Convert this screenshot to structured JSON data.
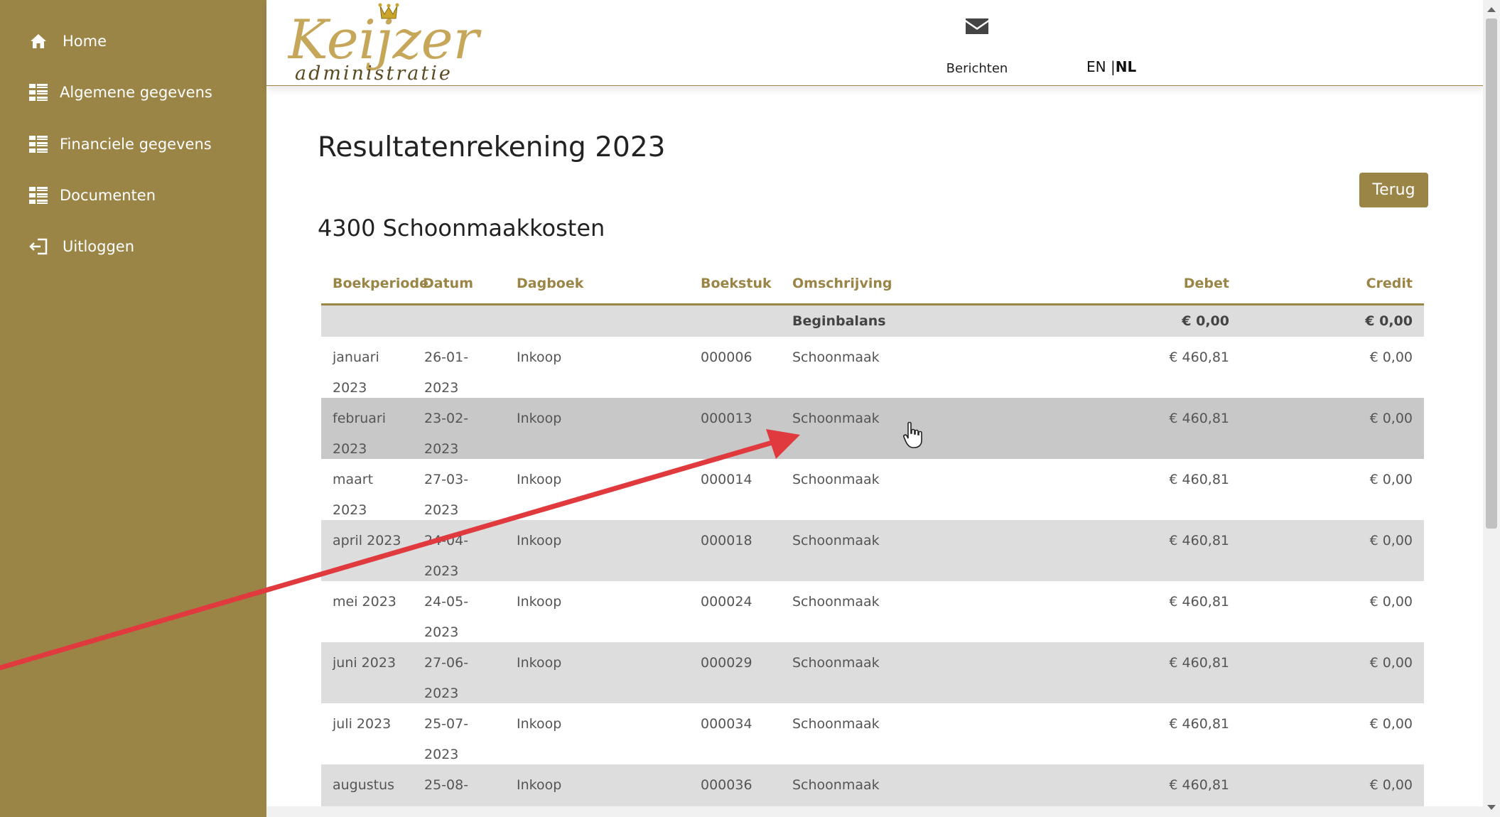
{
  "sidebar": {
    "items": [
      {
        "label": "Home",
        "icon": "home-icon"
      },
      {
        "label": "Algemene gegevens",
        "icon": "list-icon"
      },
      {
        "label": "Financiele gegevens",
        "icon": "list-icon"
      },
      {
        "label": "Documenten",
        "icon": "list-icon"
      },
      {
        "label": "Uitloggen",
        "icon": "logout-icon"
      }
    ]
  },
  "header": {
    "logo_text": "Keijzer",
    "logo_subtext": "administratie",
    "messages_label": "Berichten",
    "lang_en": "EN",
    "lang_sep": "|",
    "lang_nl": "NL"
  },
  "main": {
    "title": "Resultatenrekening 2023",
    "back_label": "Terug",
    "subtitle": "4300 Schoonmaakkosten"
  },
  "table": {
    "headers": {
      "boekperiode": "Boekperiode",
      "datum": "Datum",
      "dagboek": "Dagboek",
      "boekstuk": "Boekstuk",
      "omschrijving": "Omschrijving",
      "debet": "Debet",
      "credit": "Credit"
    },
    "begin": {
      "omschrijving": "Beginbalans",
      "debet": "€ 0,00",
      "credit": "€ 0,00"
    },
    "rows": [
      {
        "period1": "januari",
        "period2": "2023",
        "datum1": "26-01-",
        "datum2": "2023",
        "dagboek": "Inkoop",
        "boekstuk": "000006",
        "omschrijving": "Schoonmaak",
        "debet": "€ 460,81",
        "credit": "€ 0,00"
      },
      {
        "period1": "februari",
        "period2": "2023",
        "datum1": "23-02-",
        "datum2": "2023",
        "dagboek": "Inkoop",
        "boekstuk": "000013",
        "omschrijving": "Schoonmaak",
        "debet": "€ 460,81",
        "credit": "€ 0,00"
      },
      {
        "period1": "maart",
        "period2": "2023",
        "datum1": "27-03-",
        "datum2": "2023",
        "dagboek": "Inkoop",
        "boekstuk": "000014",
        "omschrijving": "Schoonmaak",
        "debet": "€ 460,81",
        "credit": "€ 0,00"
      },
      {
        "period1": "april 2023",
        "period2": "",
        "datum1": "24-04-",
        "datum2": "2023",
        "dagboek": "Inkoop",
        "boekstuk": "000018",
        "omschrijving": "Schoonmaak",
        "debet": "€ 460,81",
        "credit": "€ 0,00"
      },
      {
        "period1": "mei 2023",
        "period2": "",
        "datum1": "24-05-",
        "datum2": "2023",
        "dagboek": "Inkoop",
        "boekstuk": "000024",
        "omschrijving": "Schoonmaak",
        "debet": "€ 460,81",
        "credit": "€ 0,00"
      },
      {
        "period1": "juni 2023",
        "period2": "",
        "datum1": "27-06-",
        "datum2": "2023",
        "dagboek": "Inkoop",
        "boekstuk": "000029",
        "omschrijving": "Schoonmaak",
        "debet": "€ 460,81",
        "credit": "€ 0,00"
      },
      {
        "period1": "juli 2023",
        "period2": "",
        "datum1": "25-07-",
        "datum2": "2023",
        "dagboek": "Inkoop",
        "boekstuk": "000034",
        "omschrijving": "Schoonmaak",
        "debet": "€ 460,81",
        "credit": "€ 0,00"
      },
      {
        "period1": "augustus",
        "period2": "",
        "datum1": "25-08-",
        "datum2": "",
        "dagboek": "Inkoop",
        "boekstuk": "000036",
        "omschrijving": "Schoonmaak",
        "debet": "€ 460,81",
        "credit": "€ 0,00"
      }
    ]
  },
  "colors": {
    "brand": "#9a8546",
    "row_alt": "#dddddd",
    "row_hover": "#c8c8c8",
    "annotation_arrow": "#e0393e"
  }
}
